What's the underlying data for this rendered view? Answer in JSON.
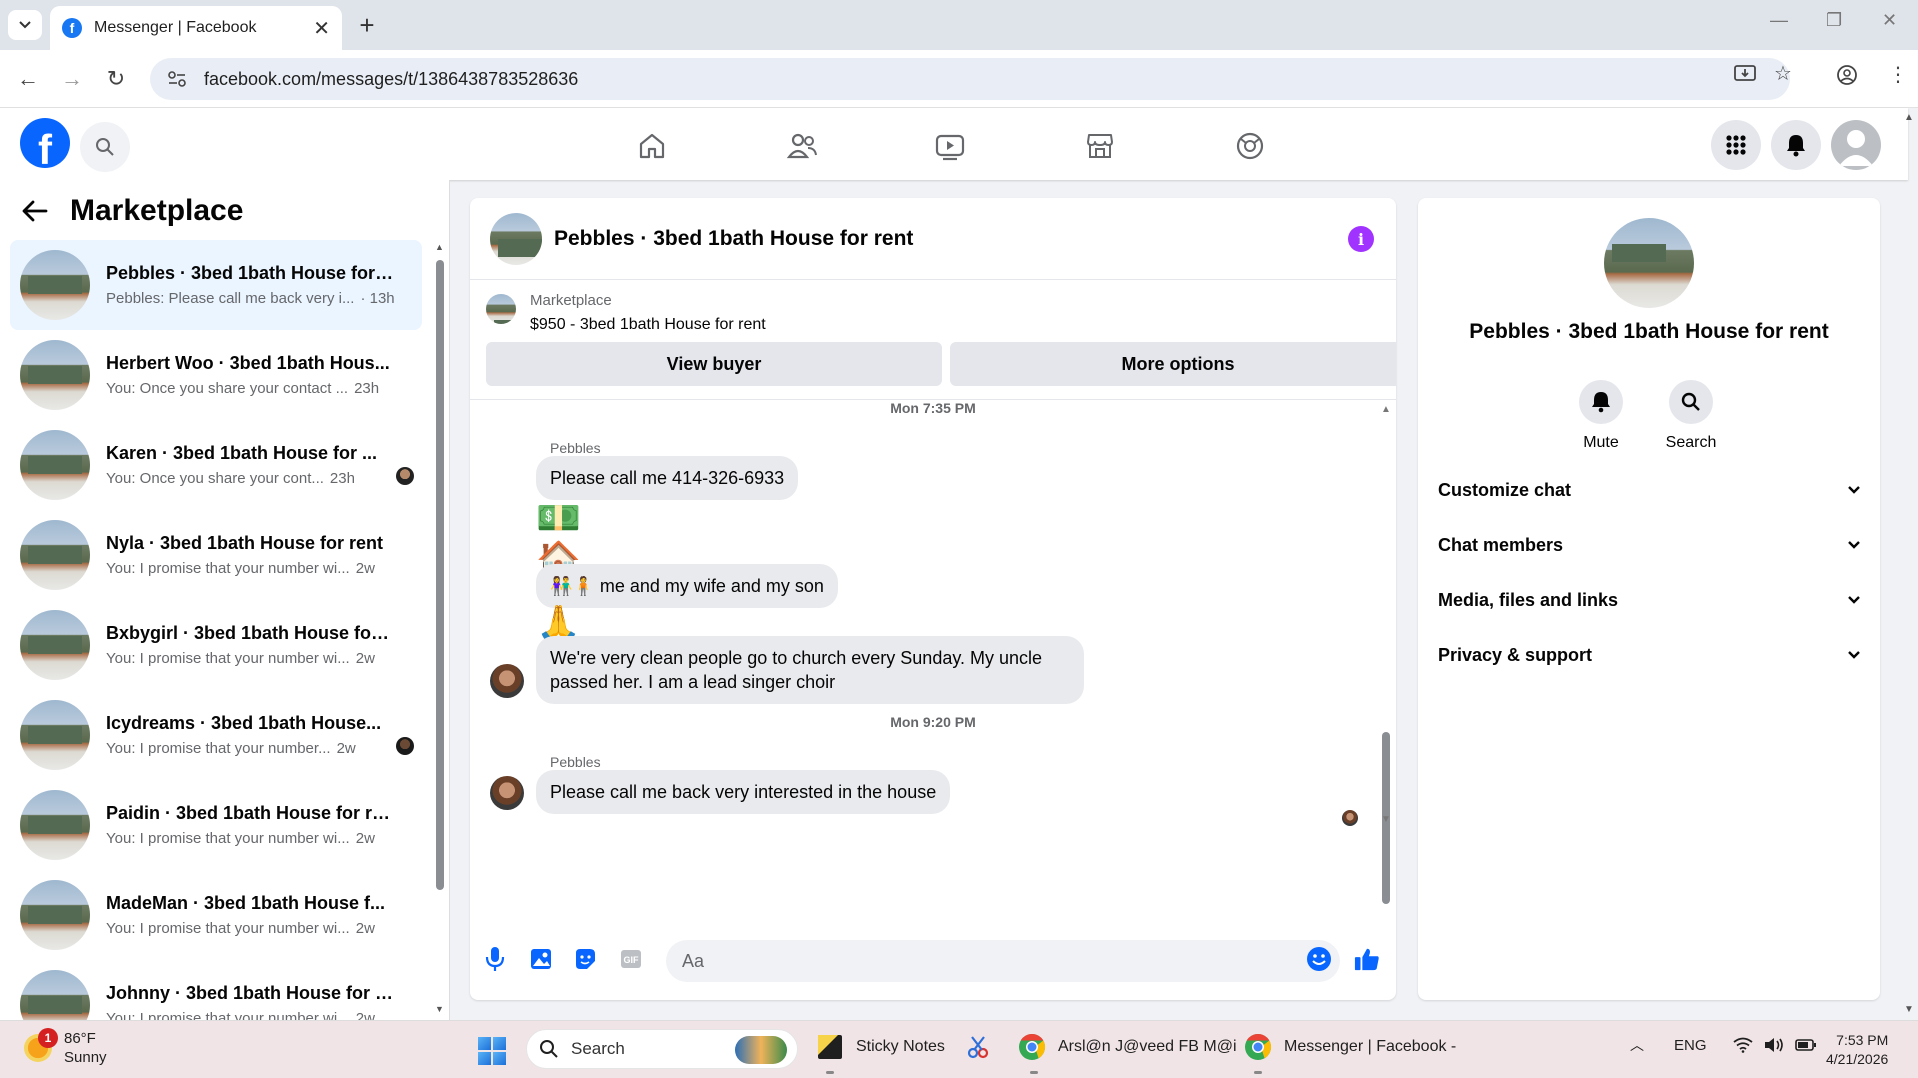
{
  "browser": {
    "tab_title": "Messenger | Facebook",
    "url": "facebook.com/messages/t/1386438783528636"
  },
  "sidebar": {
    "title": "Marketplace",
    "conversations": [
      {
        "name": "Pebbles · 3bed 1bath House for r...",
        "preview": "Pebbles: Please call me back very i...",
        "time": "· 13h",
        "active": true
      },
      {
        "name": "Herbert Woo · 3bed 1bath Hous...",
        "preview": "You: Once you share your contact ...",
        "time": "23h"
      },
      {
        "name": "Karen · 3bed 1bath House for ...",
        "preview": "You: Once you share your cont...",
        "time": "23h"
      },
      {
        "name": "Nyla · 3bed 1bath House for rent",
        "preview": "You: I promise that your number wi...",
        "time": "2w"
      },
      {
        "name": "Bxbygirl · 3bed 1bath House for ...",
        "preview": "You: I promise that your number wi...",
        "time": "2w"
      },
      {
        "name": "Icydreams · 3bed 1bath House...",
        "preview": "You: I promise that your number...",
        "time": "2w"
      },
      {
        "name": "Paidin · 3bed 1bath House for rent",
        "preview": "You: I promise that your number wi...",
        "time": "2w"
      },
      {
        "name": "MadeMan · 3bed 1bath House f...",
        "preview": "You: I promise that your number wi...",
        "time": "2w"
      },
      {
        "name": "Johnny · 3bed 1bath House for r...",
        "preview": "You: I promise that your number wi...",
        "time": "2w"
      }
    ]
  },
  "chat": {
    "title": "Pebbles · 3bed 1bath House for rent",
    "listing_label": "Marketplace",
    "listing_price": "$950 - 3bed 1bath House for rent",
    "view_buyer": "View buyer",
    "more_options": "More options",
    "ts1": "Mon 7:35 PM",
    "sender1": "Pebbles",
    "msg1": "Please call me 414-326-6933",
    "emoji_money": "💵",
    "emoji_house": "🏠",
    "msg2_emoji": "👫🧍",
    "msg2": "me and my wife and my son",
    "emoji_pray": "🙏",
    "msg3": "We're very clean people go to church every Sunday. My uncle passed her. I am a lead singer choir",
    "ts2": "Mon 9:20 PM",
    "sender2": "Pebbles",
    "msg4": "Please call me back very interested in the house",
    "input_placeholder": "Aa"
  },
  "panel": {
    "title": "Pebbles · 3bed 1bath House for rent",
    "mute": "Mute",
    "search": "Search",
    "sections": [
      "Customize chat",
      "Chat members",
      "Media, files and links",
      "Privacy & support"
    ]
  },
  "taskbar": {
    "temp": "86°F",
    "condition": "Sunny",
    "weather_badge": "1",
    "search": "Search",
    "app1": "Sticky Notes",
    "app2": "Arsl@n J@veed FB M@i",
    "app3": "Messenger | Facebook -",
    "lang": "ENG",
    "time": "7:53 PM",
    "date": "4/21/2026"
  },
  "colors": {
    "fb_blue": "#0866ff",
    "info_purple": "#a033ff",
    "bubble_gray": "#e9eaed"
  }
}
